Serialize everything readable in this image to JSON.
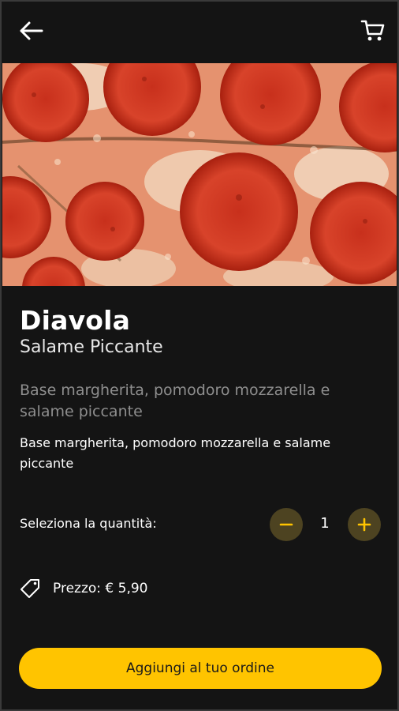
{
  "header": {
    "back_icon": "arrow-left-icon",
    "cart_icon": "shopping-cart-icon"
  },
  "product": {
    "image_subject": "pepperoni pizza close-up",
    "name": "Diavola",
    "subtitle": "Salame Piccante",
    "description_large": "Base margherita, pomodoro mozzarella e salame piccante",
    "description_small": "Base margherita, pomodoro mozzarella e salame piccante"
  },
  "quantity": {
    "label": "Seleziona la quantità:",
    "value": "1",
    "minus_icon": "minus-icon",
    "plus_icon": "plus-icon"
  },
  "price": {
    "icon": "price-tag-icon",
    "text": "Prezzo: € 5,90"
  },
  "action": {
    "add_label": "Aggiungi al tuo ordine"
  },
  "colors": {
    "background": "#141414",
    "accent": "#ffc400",
    "stepper_bg": "#4d4321",
    "muted_text": "#8e8e8e"
  }
}
